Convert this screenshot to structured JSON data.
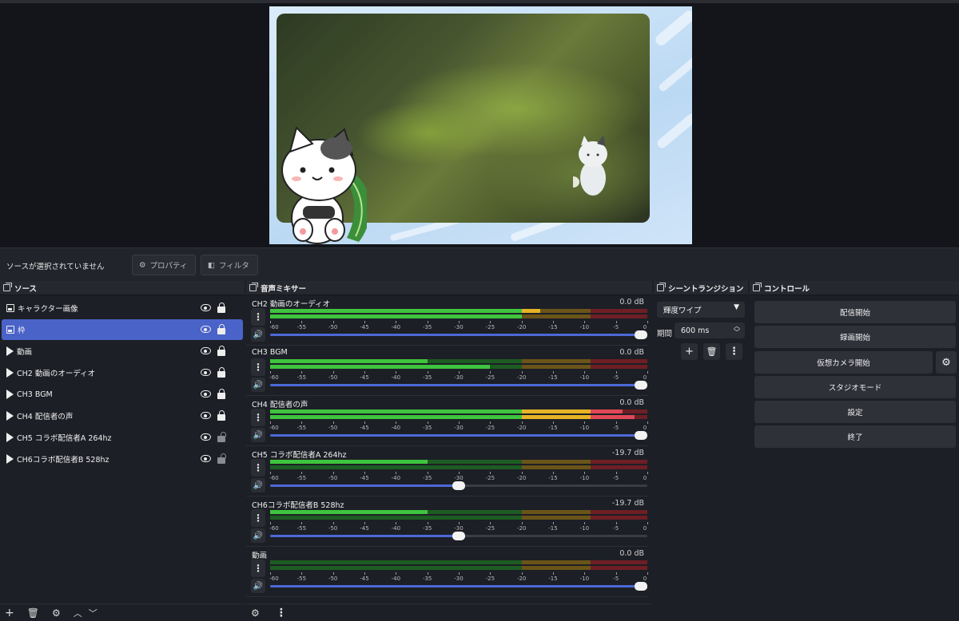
{
  "status": {
    "no_source": "ソースが選択されていません",
    "properties": "プロパティ",
    "filters": "フィルタ"
  },
  "sources": {
    "title": "ソース",
    "items": [
      {
        "label": "キャラクター画像",
        "type": "image",
        "locked": true
      },
      {
        "label": "枠",
        "type": "image",
        "locked": true,
        "selected": true
      },
      {
        "label": "動画",
        "type": "media",
        "locked": true
      },
      {
        "label": "CH2 動画のオーディオ",
        "type": "media",
        "locked": true
      },
      {
        "label": "CH3 BGM",
        "type": "media",
        "locked": true
      },
      {
        "label": "CH4 配信者の声",
        "type": "media",
        "locked": true
      },
      {
        "label": "CH5 コラボ配信者A 264hz",
        "type": "media",
        "locked": false
      },
      {
        "label": "CH6コラボ配信者B 528hz",
        "type": "media",
        "locked": false
      }
    ]
  },
  "mixer": {
    "title": "音声ミキサー",
    "scale": [
      "-60",
      "-55",
      "-50",
      "-45",
      "-40",
      "-35",
      "-30",
      "-25",
      "-20",
      "-15",
      "-10",
      "-5",
      "0"
    ],
    "channels": [
      {
        "name": "CH2 動画のオーディオ",
        "db": "0.0 dB",
        "volume": 1.0,
        "level1": -17,
        "level2": -20
      },
      {
        "name": "CH3 BGM",
        "db": "0.0 dB",
        "volume": 1.0,
        "level1": -35,
        "level2": -25
      },
      {
        "name": "CH4 配信者の声",
        "db": "0.0 dB",
        "volume": 1.0,
        "level1": -4,
        "level2": -2
      },
      {
        "name": "CH5 コラボ配信者A 264hz",
        "db": "-19.7 dB",
        "volume": 0.5,
        "level1": -35,
        "level2": -60
      },
      {
        "name": "CH6コラボ配信者B 528hz",
        "db": "-19.7 dB",
        "volume": 0.5,
        "level1": -35,
        "level2": -60
      },
      {
        "name": "動画",
        "db": "0.0 dB",
        "volume": 1.0,
        "level1": -60,
        "level2": -60
      }
    ]
  },
  "transitions": {
    "title": "シーントランジション",
    "selected": "輝度ワイプ",
    "duration_label": "期間",
    "duration_value": "600 ms"
  },
  "controls": {
    "title": "コントロール",
    "start_stream": "配信開始",
    "start_record": "録画開始",
    "start_vcam": "仮想カメラ開始",
    "studio_mode": "スタジオモード",
    "settings": "設定",
    "exit": "終了"
  },
  "colors": {
    "accent": "#4a63c9",
    "meter_green": "#3ec43e",
    "meter_green_dim": "#1d5c22",
    "meter_yellow": "#e6b325",
    "meter_yellow_dim": "#6a5418",
    "meter_red": "#e04856",
    "meter_red_dim": "#6e1e24"
  }
}
